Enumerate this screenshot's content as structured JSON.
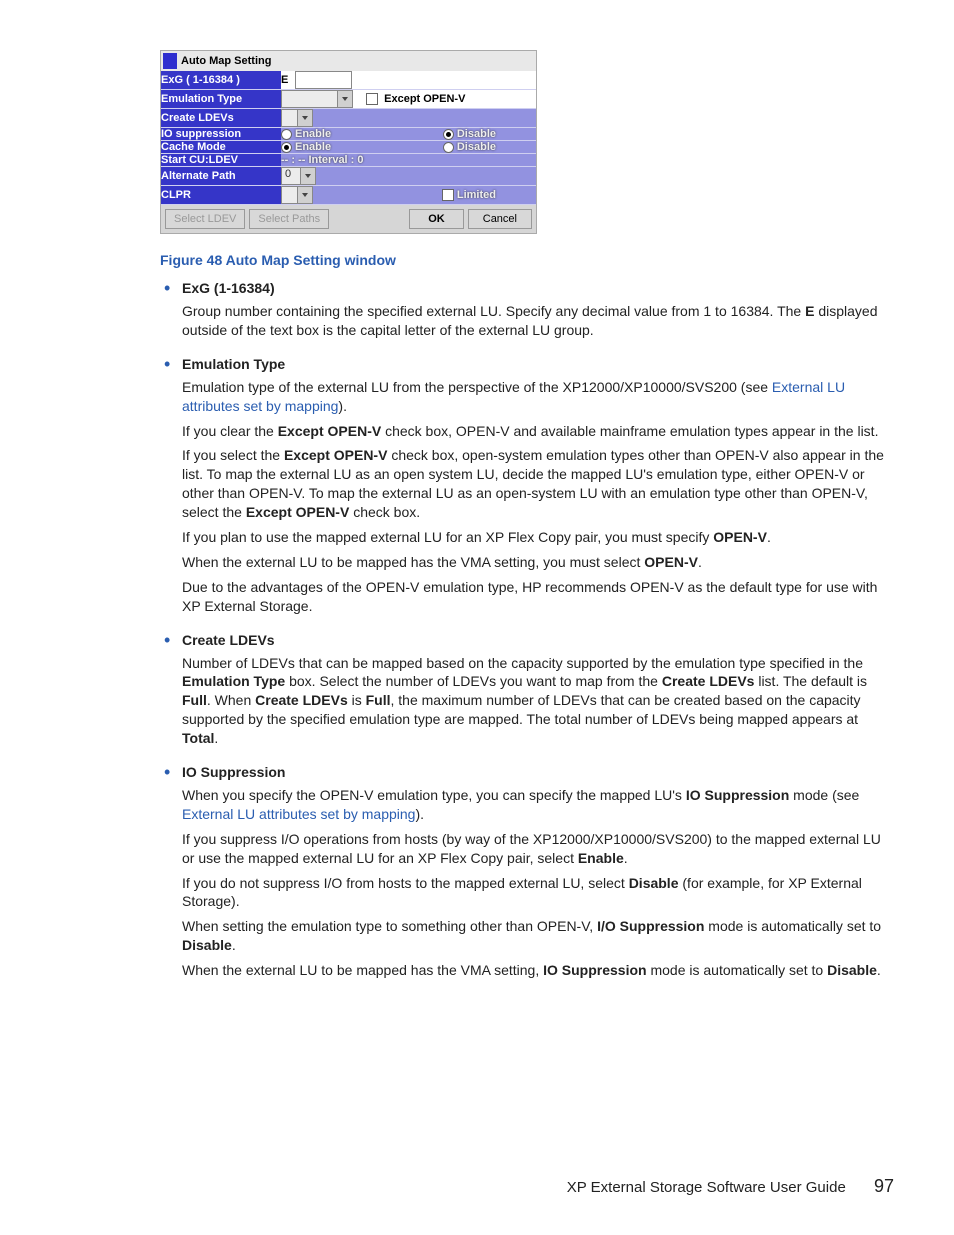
{
  "dialog": {
    "title": "Auto Map Setting",
    "rows": {
      "exg_label": "ExG ( 1-16384 )",
      "exg_prefix": "E",
      "emu_label": "Emulation Type",
      "emu_except": "Except OPEN-V",
      "create_label": "Create LDEVs",
      "io_label": "IO suppression",
      "io_enable": "Enable",
      "io_disable": "Disable",
      "cache_label": "Cache Mode",
      "cache_enable": "Enable",
      "cache_disable": "Disable",
      "start_label": "Start CU:LDEV",
      "start_val": "-- : --    Interval : 0",
      "alt_label": "Alternate Path",
      "alt_val": "0",
      "clpr_label": "CLPR",
      "clpr_limited": "Limited"
    },
    "buttons": {
      "select_ldev": "Select LDEV",
      "select_paths": "Select Paths",
      "ok": "OK",
      "cancel": "Cancel"
    }
  },
  "caption": "Figure 48 Auto Map Setting window",
  "items": {
    "exg": {
      "head": "ExG (1-16384)",
      "p1a": "Group number containing the specified external LU. Specify any decimal value from 1 to 16384. The ",
      "p1b": "E",
      "p1c": " displayed outside of the text box is the capital letter of the external LU group."
    },
    "emu": {
      "head": "Emulation Type",
      "p1a": "Emulation type of the external LU from the perspective of the XP12000/XP10000/SVS200 (see ",
      "p1link": "External LU attributes set by mapping",
      "p1b": ").",
      "p2a": "If you clear the ",
      "p2b": "Except OPEN-V",
      "p2c": " check box, OPEN-V and available mainframe emulation types appear in the list.",
      "p3a": "If you select the ",
      "p3b": "Except OPEN-V",
      "p3c": " check box, open-system emulation types other than OPEN-V also appear in the list. To map the external LU as an open system LU, decide the mapped LU's emulation type, either OPEN-V or other than OPEN-V. To map the external LU as an open-system LU with an emulation type other than OPEN-V, select the ",
      "p3d": "Except OPEN-V",
      "p3e": " check box.",
      "p4a": "If you plan to use the mapped external LU for an XP Flex Copy pair, you must specify ",
      "p4b": "OPEN-V",
      "p4c": ".",
      "p5a": "When the external LU to be mapped has the VMA setting, you must select ",
      "p5b": "OPEN-V",
      "p5c": ".",
      "p6": "Due to the advantages of the OPEN-V emulation type, HP recommends OPEN-V as the default type for use with XP External Storage."
    },
    "create": {
      "head": "Create LDEVs",
      "p1a": "Number of LDEVs that can be mapped based on the capacity supported by the emulation type specified in the ",
      "p1b": "Emulation Type",
      "p1c": " box. Select the number of LDEVs you want to map from the ",
      "p1d": "Create LDEVs",
      "p1e": " list. The default is ",
      "p1f": "Full",
      "p1g": ". When ",
      "p1h": "Create LDEVs",
      "p1i": " is ",
      "p1j": "Full",
      "p1k": ", the maximum number of LDEVs that can be created based on the capacity supported by the specified emulation type are mapped. The total number of LDEVs being mapped appears at ",
      "p1l": "Total",
      "p1m": "."
    },
    "io": {
      "head": "IO Suppression",
      "p1a": "When you specify the OPEN-V emulation type, you can specify the mapped LU's ",
      "p1b": "IO Suppression",
      "p1c": " mode (see ",
      "p1link": "External LU attributes set by mapping",
      "p1d": ").",
      "p2a": "If you suppress I/O operations from hosts (by way of the XP12000/XP10000/SVS200) to the mapped external LU or use the mapped external LU for an XP Flex Copy pair, select ",
      "p2b": "Enable",
      "p2c": ".",
      "p3a": "If you do not suppress I/O from hosts to the mapped external LU, select ",
      "p3b": "Disable",
      "p3c": " (for example, for XP External Storage).",
      "p4a": "When setting the emulation type to something other than OPEN-V, ",
      "p4b": "I/O Suppression",
      "p4c": " mode is automatically set to ",
      "p4d": "Disable",
      "p4e": ".",
      "p5a": "When the external LU to be mapped has the VMA setting, ",
      "p5b": "IO Suppression",
      "p5c": " mode is automatically set to ",
      "p5d": "Disable",
      "p5e": "."
    }
  },
  "footer": {
    "title": "XP External Storage Software User Guide",
    "page": "97"
  }
}
